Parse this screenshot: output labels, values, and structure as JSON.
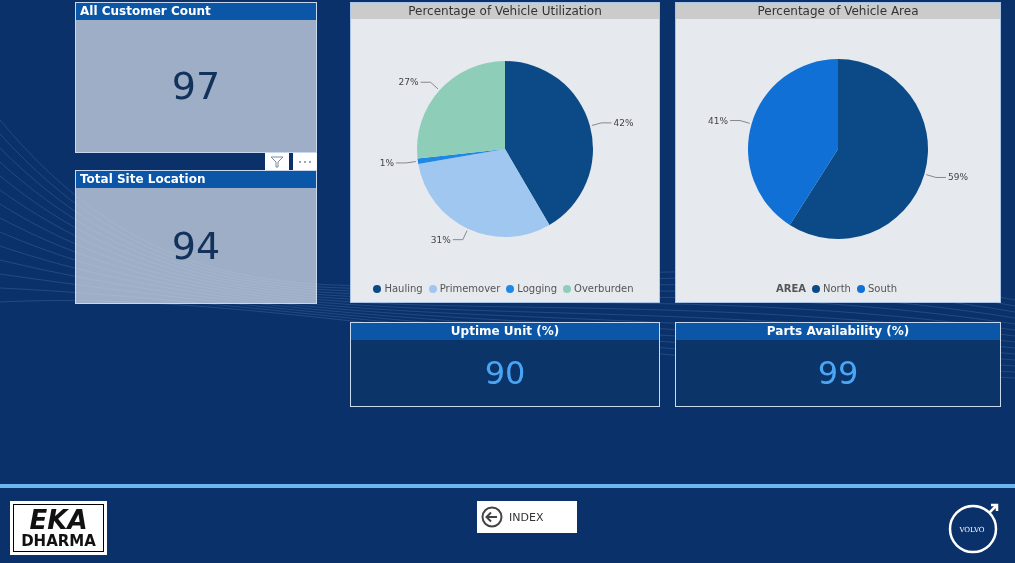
{
  "cards": [
    {
      "title": "All Customer Count",
      "value": "97",
      "kind": "light"
    },
    {
      "title": "Total Site Location",
      "value": "94",
      "kind": "light"
    }
  ],
  "charts": [
    {
      "title": "Percentage of Vehicle Utilization",
      "chart_data": {
        "type": "pie",
        "categories": [
          "Hauling",
          "Primemover",
          "Logging",
          "Overburden"
        ],
        "values": [
          42,
          31,
          1,
          27
        ],
        "colors": [
          "#0b4a86",
          "#9fc7ef",
          "#1e88e5",
          "#8ecdb8"
        ],
        "data_labels": true,
        "value_labels": [
          "42%",
          "31%",
          "1%",
          "27%"
        ]
      }
    },
    {
      "title": "Percentage of Vehicle Area",
      "legend_title": "AREA",
      "chart_data": {
        "type": "pie",
        "categories": [
          "North",
          "South"
        ],
        "values": [
          59,
          41
        ],
        "colors": [
          "#0b4a86",
          "#1170d6"
        ],
        "data_labels": true,
        "value_labels": [
          "59%",
          "41%"
        ]
      }
    }
  ],
  "kpis": [
    {
      "title": "Uptime Unit (%)",
      "value": "90",
      "kind": "dark"
    },
    {
      "title": "Parts Availability (%)",
      "value": "99",
      "kind": "dark"
    }
  ],
  "footer": {
    "logo_left": [
      "EKA",
      "DHARMA"
    ],
    "index_button": "INDEX",
    "logo_right": "VOLVO"
  }
}
